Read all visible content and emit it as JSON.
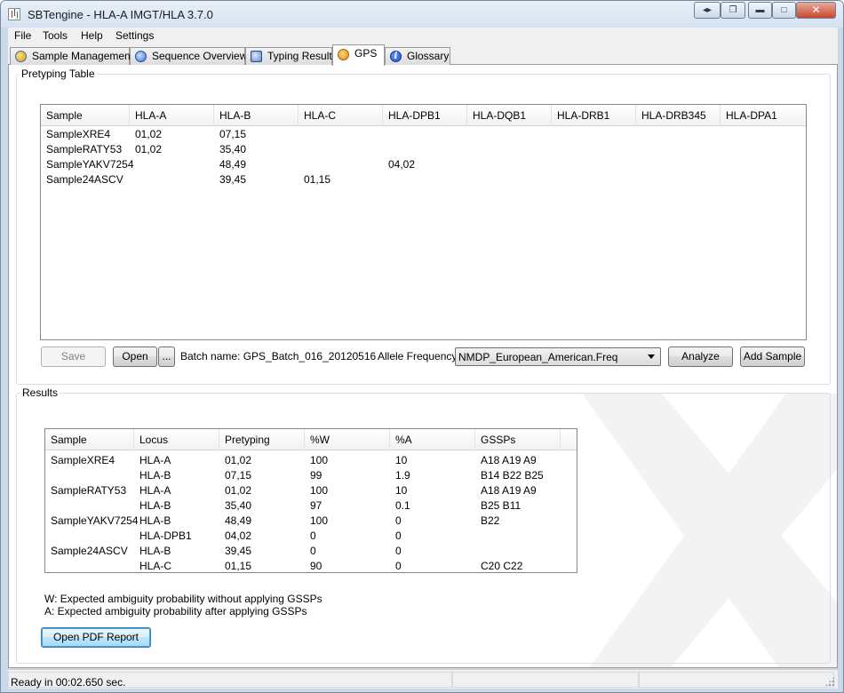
{
  "window": {
    "title": "SBTengine - HLA-A IMGT/HLA 3.7.0"
  },
  "menu": {
    "items": [
      "File",
      "Tools",
      "Help",
      "Settings"
    ]
  },
  "tabs": [
    {
      "label": "Sample Management",
      "icon": "sample-management-icon"
    },
    {
      "label": "Sequence Overview",
      "icon": "sequence-overview-icon"
    },
    {
      "label": "Typing Result",
      "icon": "typing-result-icon"
    },
    {
      "label": "GPS",
      "icon": "gps-icon",
      "active": true
    },
    {
      "label": "Glossary",
      "icon": "info-icon"
    }
  ],
  "pretyping": {
    "group_label": "Pretyping Table",
    "columns": [
      "Sample",
      "HLA-A",
      "HLA-B",
      "HLA-C",
      "HLA-DPB1",
      "HLA-DQB1",
      "HLA-DRB1",
      "HLA-DRB345",
      "HLA-DPA1"
    ],
    "rows": [
      [
        "SampleXRE4",
        "01,02",
        "07,15",
        "",
        "",
        "",
        "",
        "",
        ""
      ],
      [
        "SampleRATY53",
        "01,02",
        "35,40",
        "",
        "",
        "",
        "",
        "",
        ""
      ],
      [
        "SampleYAKV7254",
        "",
        "48,49",
        "",
        "04,02",
        "",
        "",
        "",
        ""
      ],
      [
        "Sample24ASCV",
        "",
        "39,45",
        "01,15",
        "",
        "",
        "",
        "",
        ""
      ]
    ],
    "save_label": "Save",
    "open_label": "Open",
    "browse_label": "...",
    "batch_label": "Batch name: GPS_Batch_016_20120516",
    "freq_label": "Allele Frequency:",
    "freq_value": "NMDP_European_American.Freq",
    "analyze_label": "Analyze",
    "add_sample_label": "Add Sample"
  },
  "results": {
    "group_label": "Results",
    "columns": [
      "Sample",
      "Locus",
      "Pretyping",
      "%W",
      "%A",
      "GSSPs"
    ],
    "rows": [
      [
        "SampleXRE4",
        "HLA-A",
        "01,02",
        "100",
        "10",
        "A18 A19 A9"
      ],
      [
        "",
        "HLA-B",
        "07,15",
        "99",
        "1.9",
        "B14 B22 B25"
      ],
      [
        "SampleRATY53",
        "HLA-A",
        "01,02",
        "100",
        "10",
        "A18 A19 A9"
      ],
      [
        "",
        "HLA-B",
        "35,40",
        "97",
        "0.1",
        "B25 B11"
      ],
      [
        "SampleYAKV7254",
        "HLA-B",
        "48,49",
        "100",
        "0",
        "B22"
      ],
      [
        "",
        "HLA-DPB1",
        "04,02",
        "0",
        "0",
        ""
      ],
      [
        "Sample24ASCV",
        "HLA-B",
        "39,45",
        "0",
        "0",
        ""
      ],
      [
        "",
        "HLA-C",
        "01,15",
        "90",
        "0",
        "C20 C22"
      ]
    ],
    "legend_w": "W: Expected ambiguity probability without applying GSSPs",
    "legend_a": "A: Expected ambiguity probability after applying GSSPs",
    "pdf_label": "Open PDF Report"
  },
  "status": {
    "text": "Ready in 00:02.650 sec."
  }
}
